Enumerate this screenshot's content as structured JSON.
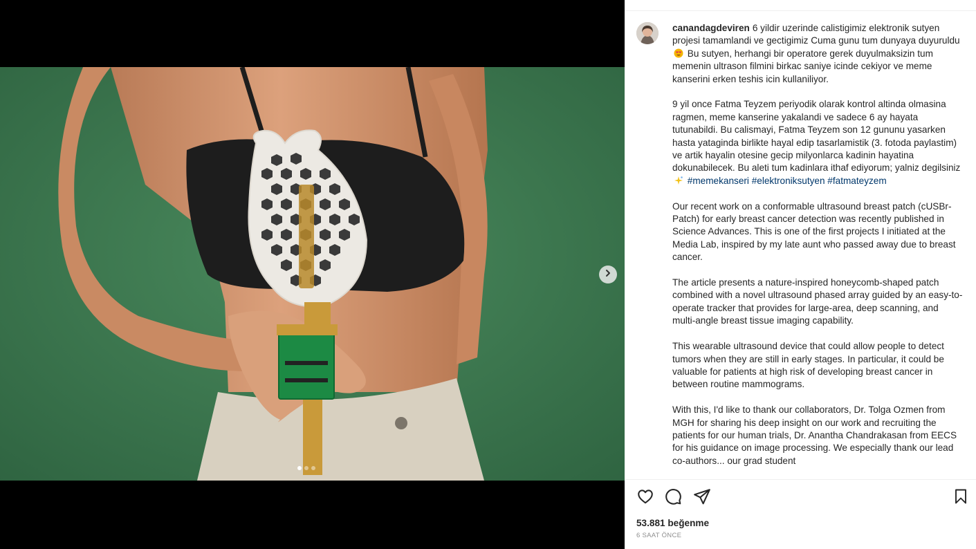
{
  "post": {
    "username": "canandagdeviren",
    "paragraphs": [
      {
        "parts": [
          {
            "t": "6 yildir uzerinde calistigimiz elektronik sutyen projesi tamamlandi ve gectigimiz Cuma gunu tum dunyaya duyuruldu"
          },
          {
            "emoji": "heart-eyes-emoji"
          },
          {
            "t": "Bu sutyen, herhangi bir operatore gerek duyulmaksizin tum memenin ultrason filmini birkac saniye icinde cekiyor ve meme kanserini erken teshis icin kullaniliyor."
          }
        ]
      },
      {
        "parts": [
          {
            "t": "9 yil once Fatma Teyzem periyodik olarak kontrol altinda olmasina ragmen, meme kanserine yakalandi ve sadece 6 ay hayata tutunabildi. Bu calismayi, Fatma Teyzem son 12 gununu yasarken hasta yataginda birlikte hayal edip tasarlamistik (3. fotoda paylastim) ve artik hayalin otesine gecip milyonlarca kadinin hayatina dokunabilecek. Bu aleti tum kadinlara ithaf ediyorum; yalniz degilsiniz"
          },
          {
            "emoji": "sparkles-emoji"
          },
          {
            "tag": "#memekanseri"
          },
          {
            "t": " "
          },
          {
            "tag": "#elektroniksutyen"
          },
          {
            "t": " "
          },
          {
            "tag": "#fatmateyzem"
          }
        ]
      },
      {
        "parts": [
          {
            "t": "Our recent work on a conformable ultrasound breast patch (cUSBr-Patch) for early breast cancer detection was recently published in Science Advances. This is one of the first projects I initiated at the Media Lab, inspired by my late aunt who passed away due to breast cancer."
          }
        ]
      },
      {
        "parts": [
          {
            "t": "The article presents a nature-inspired honeycomb-shaped patch combined with a novel ultrasound phased array guided by an easy-to-operate tracker that provides for large-area, deep scanning, and multi-angle breast tissue imaging capability."
          }
        ]
      },
      {
        "parts": [
          {
            "t": "This wearable ultrasound device that could allow people to detect tumors when they are still in early stages. In particular, it could be valuable for patients at high risk of developing breast cancer in between routine mammograms."
          }
        ]
      },
      {
        "parts": [
          {
            "t": "With this, I'd like to thank our collaborators, Dr. Tolga Ozmen from MGH for sharing his deep insight on our work and recruiting the patients for our human trials, Dr. Anantha Chandrakasan from EECS for his guidance on image processing. We especially thank our lead co-authors... our grad student"
          }
        ]
      }
    ],
    "likes": "53.881 beğenme",
    "time": "6 SAAT ÖNCE"
  },
  "carousel": {
    "slides": 3,
    "active": 0
  },
  "colors": {
    "photo_background": "#3f7a52",
    "hashtag": "#00376b",
    "text": "#262626",
    "muted": "#8e8e8e"
  },
  "icons": [
    "heart-icon",
    "comment-icon",
    "share-icon",
    "bookmark-icon",
    "chevron-right-icon"
  ]
}
